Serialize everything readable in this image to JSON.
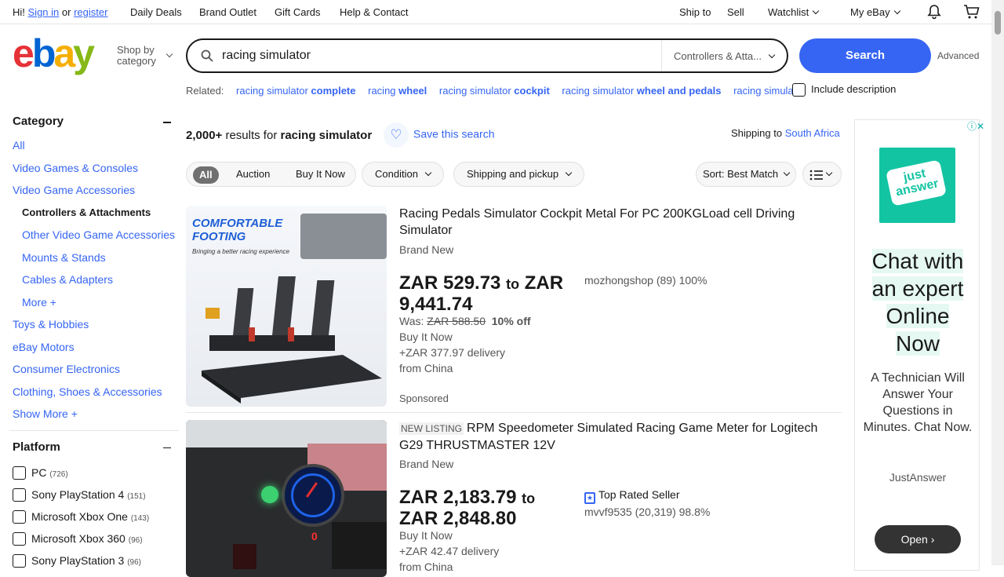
{
  "topbar": {
    "greeting": "Hi!",
    "sign_in": "Sign in",
    "or": "or",
    "register": "register",
    "links": [
      "Daily Deals",
      "Brand Outlet",
      "Gift Cards",
      "Help & Contact"
    ],
    "ship_to": "Ship to",
    "sell": "Sell",
    "watchlist": "Watchlist",
    "my_ebay": "My eBay"
  },
  "header": {
    "shop_by": "Shop by",
    "category": "category",
    "search_value": "racing simulator",
    "category_select": "Controllers & Atta...",
    "search_button": "Search",
    "advanced": "Advanced"
  },
  "related": {
    "label": "Related:",
    "items": [
      {
        "pre": "racing simulator ",
        "bold": "complete"
      },
      {
        "pre": "racing ",
        "bold": "wheel"
      },
      {
        "pre": "racing simulator ",
        "bold": "cockpit"
      },
      {
        "pre": "racing simulator ",
        "bold": "wheel and pedals"
      },
      {
        "pre": "racing simula...",
        "bold": ""
      }
    ],
    "include_description": "Include description"
  },
  "sidebar": {
    "category_title": "Category",
    "categories": [
      "All",
      "Video Games & Consoles",
      "Video Game Accessories",
      "Controllers & Attachments",
      "Other Video Game Accessories",
      "Mounts & Stands",
      "Cables & Adapters",
      "More +",
      "Toys & Hobbies",
      "eBay Motors",
      "Consumer Electronics",
      "Clothing, Shoes & Accessories",
      "Show More +"
    ],
    "platform_title": "Platform",
    "platforms": [
      {
        "name": "PC",
        "count": "(726)"
      },
      {
        "name": "Sony PlayStation 4",
        "count": "(151)"
      },
      {
        "name": "Microsoft Xbox One",
        "count": "(143)"
      },
      {
        "name": "Microsoft Xbox 360",
        "count": "(96)"
      },
      {
        "name": "Sony PlayStation 3",
        "count": "(96)"
      }
    ]
  },
  "results": {
    "count": "2,000+",
    "results_for": " results for ",
    "query": "racing simulator",
    "save_search": "Save this search",
    "shipping_to": "Shipping to",
    "country": "South Africa"
  },
  "filters": {
    "all": "All",
    "auction": "Auction",
    "buy_it_now": "Buy It Now",
    "condition": "Condition",
    "shipping": "Shipping and pickup",
    "sort": "Sort: Best Match"
  },
  "items": [
    {
      "image_text1": "COMFORTABLE",
      "image_text2": "FOOTING",
      "image_text3": "Bringing a better racing experience",
      "title": "Racing Pedals Simulator Cockpit Metal For PC 200KGLoad cell Driving Simulator",
      "condition": "Brand New",
      "price_from": "ZAR 529.73",
      "to": "to",
      "price_to": "ZAR 9,441.74",
      "was_label": "Was:",
      "was_price": "ZAR 588.50",
      "off": "10% off",
      "format": "Buy It Now",
      "delivery": "+ZAR 377.97 delivery",
      "from": "from China",
      "seller": "mozhongshop (89) 100%",
      "sponsored": "Sponsored"
    },
    {
      "new_listing": "NEW LISTING",
      "title": "RPM Speedometer Simulated Racing Game Meter for Logitech G29 THRUSTMASTER 12V",
      "condition": "Brand New",
      "price_from": "ZAR 2,183.79",
      "to": "to",
      "price_to": "ZAR 2,848.80",
      "top_rated": "Top Rated Seller",
      "seller": "mvvf9535 (20,319) 98.8%",
      "format": "Buy It Now",
      "delivery": "+ZAR 42.47 delivery",
      "from": "from China",
      "meter_digit": "0"
    }
  ],
  "ad": {
    "logo_line1": "just",
    "logo_line2": "answer",
    "headline": [
      "Chat with",
      "an expert",
      "Online",
      "Now"
    ],
    "body": "A Technician Will Answer Your Questions in Minutes. Chat Now.",
    "brand": "JustAnswer",
    "open": "Open"
  }
}
